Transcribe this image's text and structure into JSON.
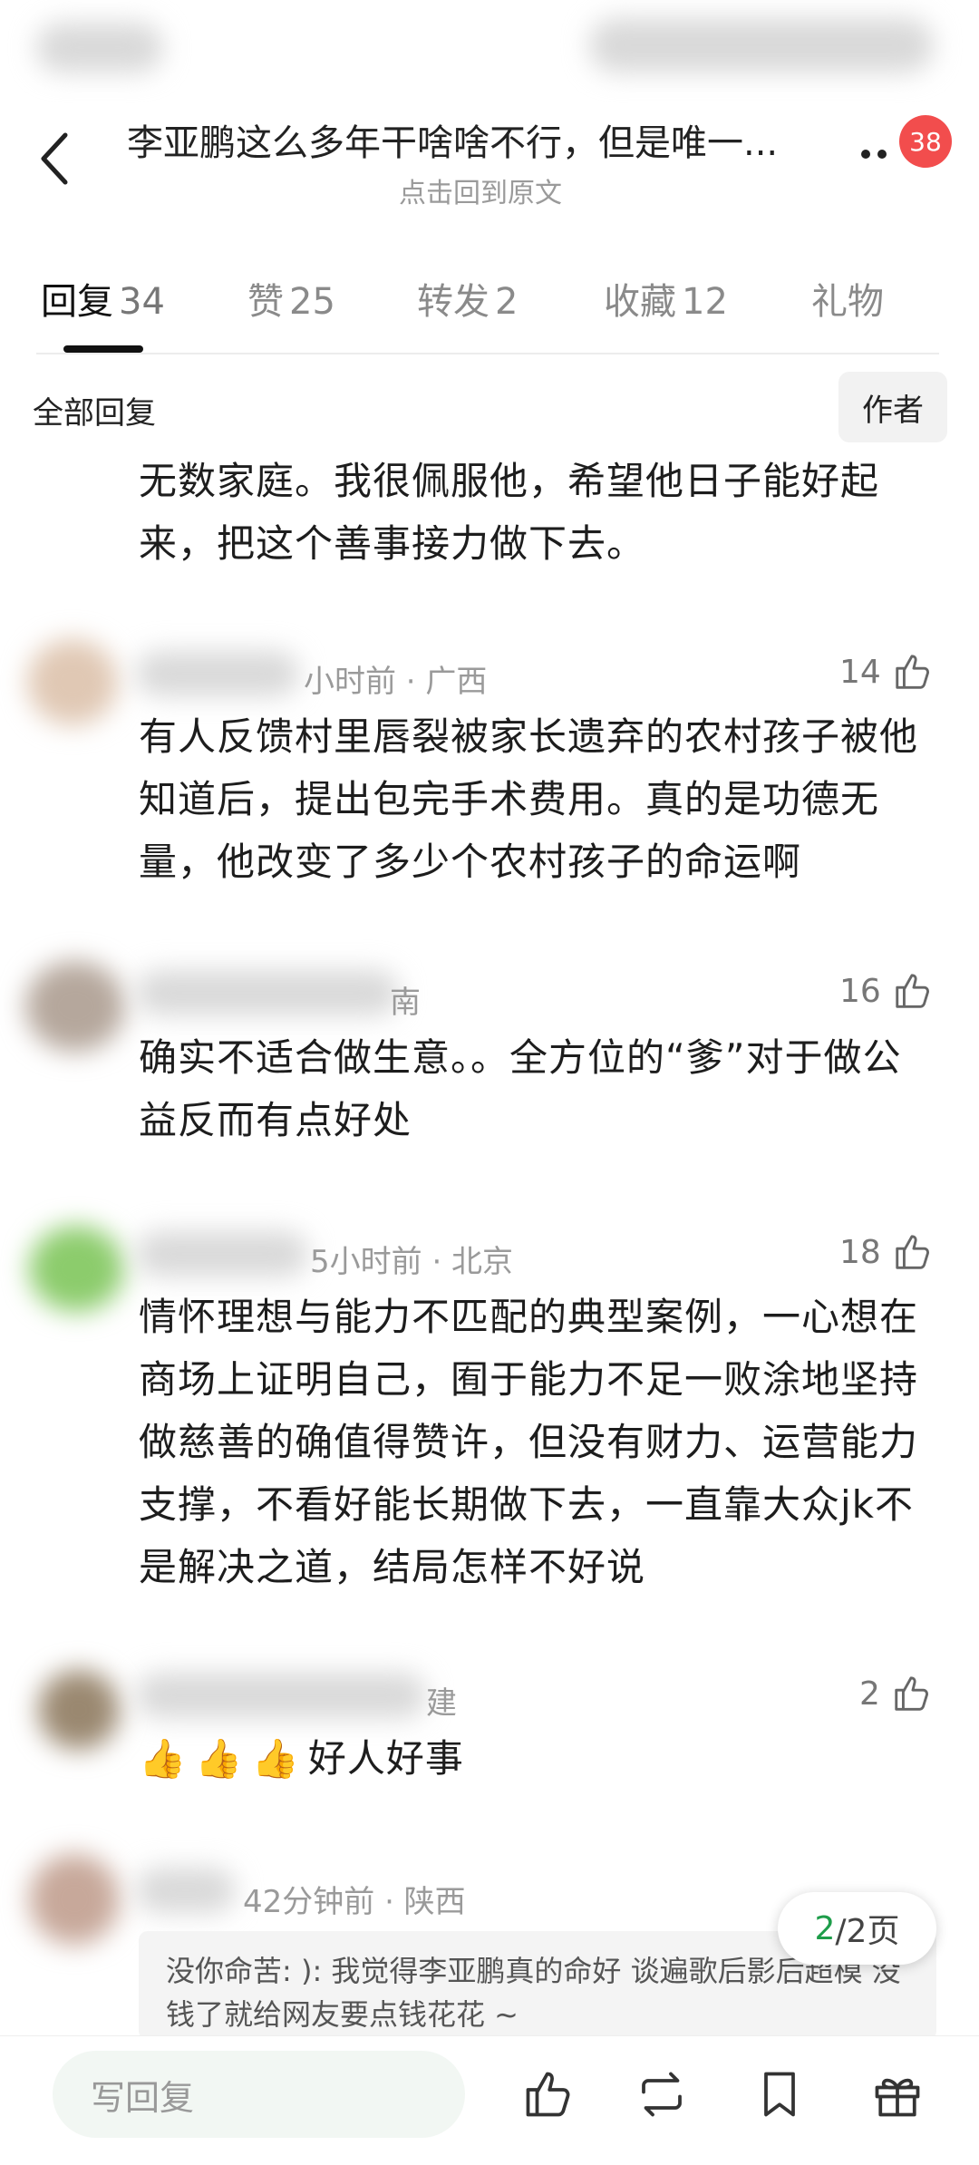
{
  "header": {
    "title": "李亚鹏这么多年干啥啥不行，但是唯一...",
    "subtitle": "点击回到原文",
    "badge_count": "38"
  },
  "tabs": [
    {
      "label": "回复",
      "count": "34",
      "active": true
    },
    {
      "label": "赞",
      "count": "25"
    },
    {
      "label": "转发",
      "count": "2"
    },
    {
      "label": "收藏",
      "count": "12"
    },
    {
      "label": "礼物",
      "count": ""
    }
  ],
  "filter": {
    "all_replies": "全部回复",
    "author_button": "作者"
  },
  "comments": [
    {
      "text": "无数家庭。我很佩服他，希望他日子能好起来，把这个善事接力做下去。"
    },
    {
      "meta": "小时前 · 广西",
      "likes": "14",
      "text": "有人反馈村里唇裂被家长遗弃的农村孩子被他知道后，提出包完手术费用。真的是功德无量，他改变了多少个农村孩子的命运啊"
    },
    {
      "meta": "南",
      "likes": "16",
      "text": "确实不适合做生意。。全方位的“爹”对于做公益反而有点好处"
    },
    {
      "meta": "5小时前 · 北京",
      "likes": "18",
      "text": "情怀理想与能力不匹配的典型案例，一心想在商场上证明自己，囿于能力不足一败涂地坚持做慈善的确值得赞许，但没有财力、运营能力支撑，不看好能长期做下去，一直靠大众jk不是解决之道，结局怎样不好说"
    },
    {
      "meta": "建",
      "likes": "2",
      "emoji": "👍👍👍",
      "text": "好人好事"
    },
    {
      "meta": "42分钟前 · 陕西",
      "likes": "",
      "reply_preview": "没你命苦: ): 我觉得李亚鹏真的命好 谈遍歌后影后超模 没钱了就给网友要点钱花花 ~"
    }
  ],
  "pagination": {
    "current": "2",
    "total": "/2页"
  },
  "bottom_bar": {
    "reply_placeholder": "写回复"
  }
}
